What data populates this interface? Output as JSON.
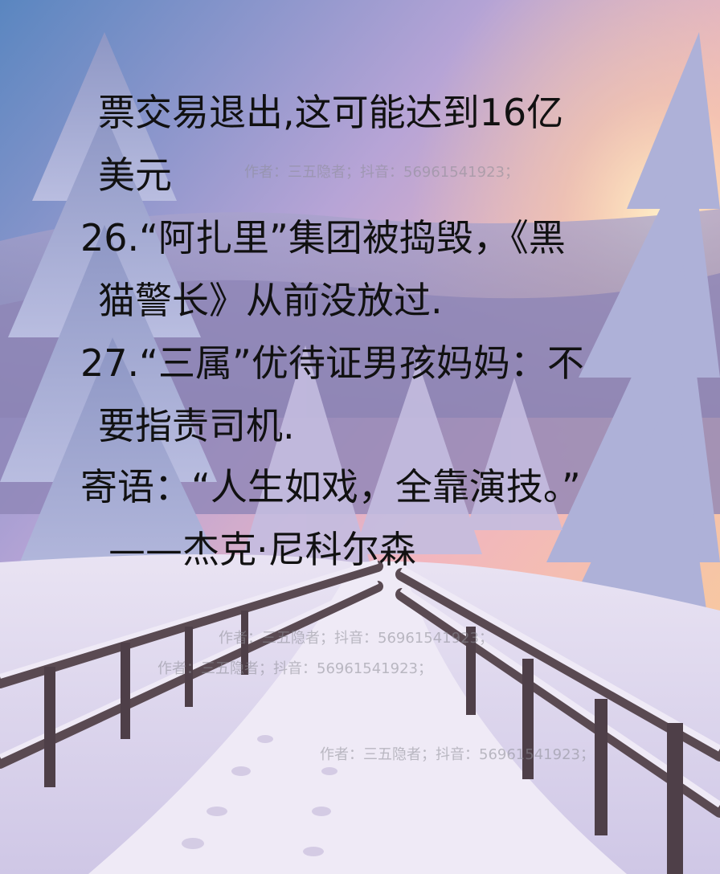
{
  "poster": {
    "lines": [
      "票交易退出,这可能达到16亿",
      "美元",
      "26.“阿扎里”集团被捣毁，《黑",
      "猫警长》从前没放过.",
      "27.“三属”优待证男孩妈妈：不",
      "要指责司机.",
      "寄语：“人生如戏，全靠演技。”",
      "——杰克·尼科尔森"
    ],
    "watermark": "作者：三五隐者；抖音：56961541923；"
  }
}
